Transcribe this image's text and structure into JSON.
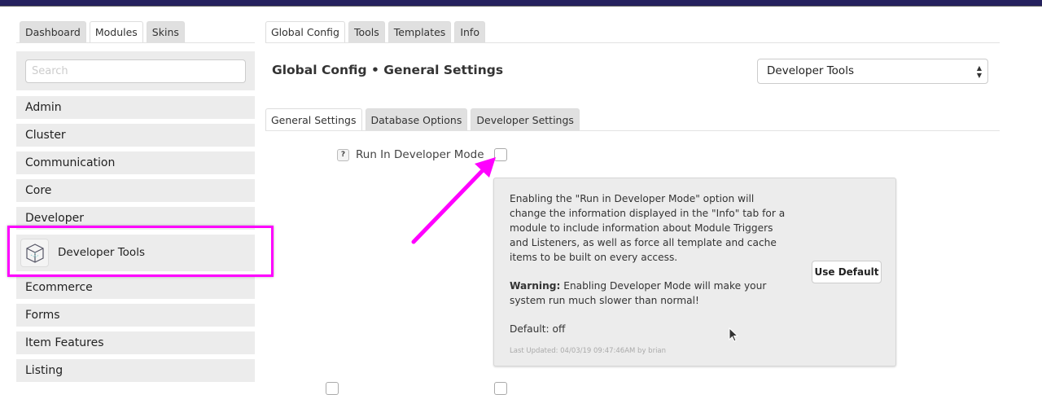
{
  "left_tabs": [
    "Dashboard",
    "Modules",
    "Skins"
  ],
  "left_active_tab": "Modules",
  "search": {
    "placeholder": "Search"
  },
  "sidebar": {
    "items_before": [
      "Admin",
      "Cluster",
      "Communication",
      "Core",
      "Developer"
    ],
    "selected": "Developer Tools",
    "items_after": [
      "Ecommerce",
      "Forms",
      "Item Features",
      "Listing"
    ]
  },
  "main_tabs": [
    "Global Config",
    "Tools",
    "Templates",
    "Info"
  ],
  "page_title": "Global Config • General Settings",
  "module_select": {
    "value": "Developer Tools"
  },
  "sub_tabs": [
    "General Settings",
    "Database Options",
    "Developer Settings"
  ],
  "setting": {
    "help_icon": "?",
    "label": "Run In Developer Mode",
    "checked": false
  },
  "help": {
    "description": "Enabling the \"Run in Developer Mode\" option will change the information displayed in the \"Info\" tab for a module to include information about Module Triggers and Listeners, as well as force all template and cache items to be built on every access.",
    "warning_label": "Warning:",
    "warning_text": " Enabling Developer Mode will make your system run much slower than normal!",
    "default": "Default: off",
    "last_updated": "Last Updated: 04/03/19 09:47:46AM by brian",
    "use_default": "Use Default"
  },
  "colors": {
    "topbar": "#25215e",
    "highlight": "#ff00ff"
  }
}
